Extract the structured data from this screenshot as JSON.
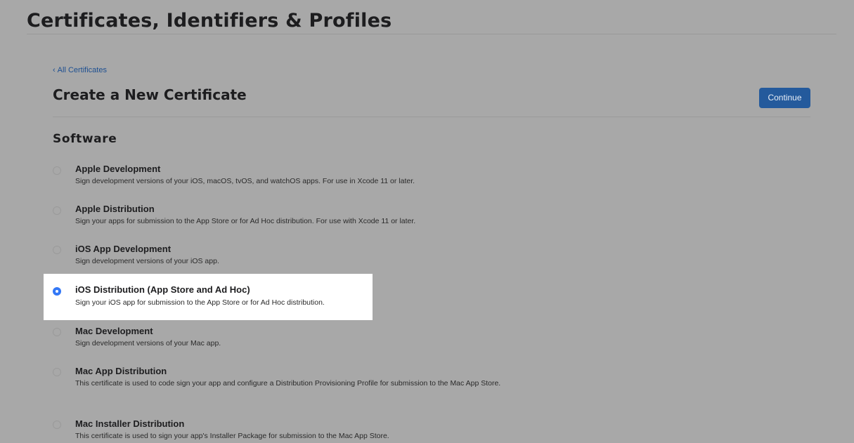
{
  "page": {
    "title": "Certificates, Identifiers & Profiles"
  },
  "nav": {
    "back_chevron": "‹",
    "back_label": "All Certificates"
  },
  "header": {
    "title": "Create a New Certificate",
    "continue_label": "Continue"
  },
  "software": {
    "title": "Software",
    "selected_index": 3,
    "options": [
      {
        "name": "Apple Development",
        "description": "Sign development versions of your iOS, macOS, tvOS, and watchOS apps. For use in Xcode 11 or later."
      },
      {
        "name": "Apple Distribution",
        "description": "Sign your apps for submission to the App Store or for Ad Hoc distribution. For use with Xcode 11 or later."
      },
      {
        "name": "iOS App Development",
        "description": "Sign development versions of your iOS app."
      },
      {
        "name": "iOS Distribution (App Store and Ad Hoc)",
        "description": "Sign your iOS app for submission to the App Store or for Ad Hoc distribution."
      },
      {
        "name": "Mac Development",
        "description": "Sign development versions of your Mac app."
      },
      {
        "name": "Mac App Distribution",
        "description": "This certificate is used to code sign your app and configure a Distribution Provisioning Profile for submission to the Mac App Store."
      },
      {
        "name": "Mac Installer Distribution",
        "description": "This certificate is used to sign your app's Installer Package for submission to the Mac App Store."
      }
    ]
  },
  "colors": {
    "page_background": "#a8a8a8",
    "accent": "#245a9c",
    "radio_selected": "#3478f6",
    "selected_row_background": "#ffffff"
  }
}
